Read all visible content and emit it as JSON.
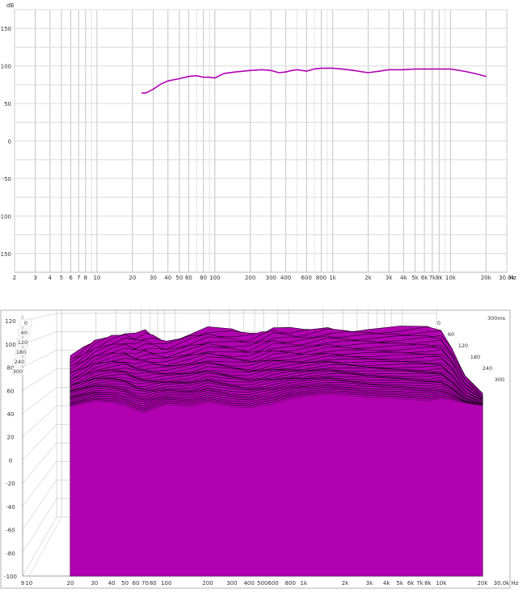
{
  "chart_data": [
    {
      "type": "line",
      "title": "",
      "unit_label": "dB",
      "x_unit_label": "Hz",
      "ylim": [
        -175,
        175
      ],
      "xlim": [
        2,
        30000
      ],
      "x_scale": "log",
      "grid": true,
      "yticks": [
        150,
        100,
        50,
        0,
        -50,
        -100,
        -150
      ],
      "ytick_labels": [
        "150",
        "100",
        "50",
        "0",
        "-50",
        "-100",
        "-150"
      ],
      "xticks": [
        2,
        3,
        4,
        5,
        6,
        7,
        8,
        10,
        20,
        30,
        40,
        50,
        60,
        80,
        100,
        200,
        300,
        400,
        600,
        800,
        1000,
        2000,
        3000,
        4000,
        5000,
        6000,
        7000,
        8000,
        10000,
        20000,
        30000
      ],
      "xtick_labels": [
        "2",
        "3",
        "4",
        "5",
        "6",
        "7",
        "8",
        "10",
        "20",
        "30",
        "40",
        "50",
        "60",
        "80",
        "100",
        "200",
        "300",
        "400",
        "600",
        "800",
        "1k",
        "2k",
        "3k",
        "4k",
        "5k",
        "6k",
        "7k",
        "8k",
        "10k",
        "20k",
        "30.0k"
      ],
      "series": [
        {
          "color": "#b300b3",
          "x": [
            24,
            26,
            30,
            35,
            40,
            50,
            60,
            70,
            80,
            90,
            100,
            120,
            150,
            200,
            250,
            300,
            350,
            400,
            450,
            500,
            600,
            700,
            800,
            1000,
            1200,
            1500,
            2000,
            2500,
            3000,
            4000,
            5000,
            6000,
            8000,
            10000,
            13000,
            16000,
            20000
          ],
          "y": [
            64,
            64,
            69,
            76,
            80,
            83,
            86,
            87,
            85,
            85,
            84,
            90,
            92,
            94,
            95,
            94,
            91,
            92,
            94,
            95,
            93,
            96,
            97,
            97,
            96,
            94,
            91,
            93,
            95,
            95,
            96,
            96,
            96,
            96,
            93,
            90,
            86
          ]
        }
      ]
    },
    {
      "type": "area",
      "subtype": "waterfall",
      "title": "",
      "x_unit_label": "Hz",
      "ylim": [
        -100,
        125
      ],
      "xlim": [
        9,
        20000
      ],
      "x_scale": "log",
      "grid": true,
      "yticks": [
        120,
        100,
        80,
        60,
        40,
        20,
        0,
        -20,
        -40,
        -60,
        -80,
        -100
      ],
      "ytick_labels": [
        "120",
        "100",
        "80",
        "60",
        "40",
        "20",
        "0",
        "-20",
        "-40",
        "-60",
        "-80",
        "-100"
      ],
      "xticks": [
        9,
        10,
        20,
        30,
        40,
        50,
        60,
        70,
        80,
        100,
        200,
        300,
        400,
        500,
        600,
        800,
        1000,
        2000,
        3000,
        4000,
        5000,
        6000,
        7000,
        8000,
        10000,
        20000
      ],
      "xtick_labels": [
        "9",
        "10",
        "20",
        "30",
        "40",
        "50",
        "60",
        "70",
        "80",
        "100",
        "200",
        "300",
        "400",
        "500",
        "600",
        "800",
        "1k",
        "2k",
        "3k",
        "4k",
        "5k",
        "6k",
        "7k",
        "8k",
        "10k",
        "20k"
      ],
      "x_end_label": "30.0k Hz",
      "time_labels_left": [
        "0",
        "60",
        "120",
        "180",
        "240",
        "300"
      ],
      "time_labels_right": [
        "0",
        "60",
        "120",
        "180",
        "240",
        "300"
      ],
      "time_unit_label": "300ms",
      "fill_color": "#b000b0",
      "slice_count": 40,
      "front_slice": {
        "x": [
          20,
          25,
          30,
          40,
          50,
          60,
          70,
          80,
          100,
          150,
          200,
          300,
          400,
          500,
          600,
          800,
          1000,
          1500,
          2000,
          3000,
          5000,
          8000,
          10000,
          12000,
          15000,
          20000
        ],
        "y": [
          46,
          49,
          51,
          50,
          47,
          43,
          41,
          44,
          48,
          46,
          50,
          46,
          45,
          47,
          48,
          53,
          55,
          57,
          56,
          54,
          53,
          51,
          53,
          52,
          49,
          47
        ]
      },
      "back_slice": {
        "x": [
          20,
          25,
          30,
          40,
          50,
          60,
          70,
          80,
          100,
          150,
          200,
          300,
          400,
          500,
          600,
          800,
          1000,
          1500,
          2000,
          3000,
          5000,
          8000,
          10000,
          12000,
          15000,
          20000
        ],
        "y": [
          82,
          88,
          95,
          101,
          104,
          101,
          103,
          100,
          96,
          103,
          106,
          104,
          102,
          105,
          108,
          105,
          104,
          107,
          106,
          106,
          106,
          107,
          105,
          90,
          65,
          48
        ]
      }
    }
  ]
}
